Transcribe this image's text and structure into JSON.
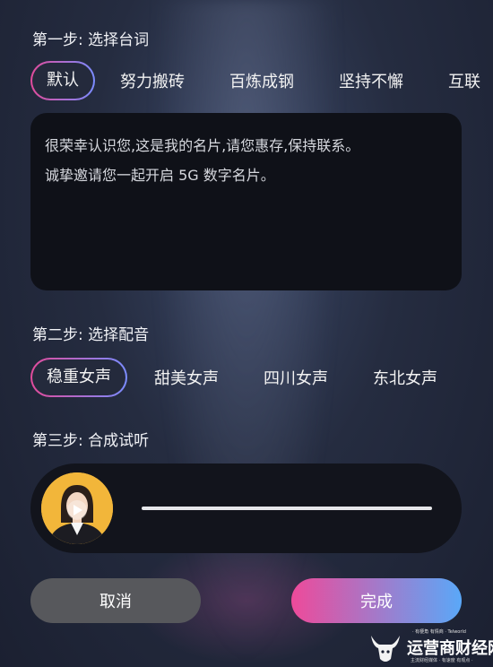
{
  "step1": {
    "title": "第一步: 选择台词"
  },
  "script_tabs": [
    "默认",
    "努力搬砖",
    "百炼成钢",
    "坚持不懈",
    "互联"
  ],
  "script_text": [
    "很荣幸认识您,这是我的名片,请您惠存,保持联系。",
    "诚挚邀请您一起开启 5G 数字名片。"
  ],
  "step2": {
    "title": "第二步: 选择配音"
  },
  "voice_tabs": [
    "稳重女声",
    "甜美女声",
    "四川女声",
    "东北女声"
  ],
  "step3": {
    "title": "第三步: 合成试听"
  },
  "player": {
    "progress": 0
  },
  "buttons": {
    "cancel": "取消",
    "done": "完成"
  },
  "watermark": {
    "brand": "运营商财经网",
    "tagline": "· 有梗角 有情商 · Telworld",
    "subtitle": "主流财经媒体 · 有速度 有观点 ·"
  },
  "colors": {
    "accent_pink": "#e94a9c",
    "accent_blue": "#5aa8f8"
  }
}
